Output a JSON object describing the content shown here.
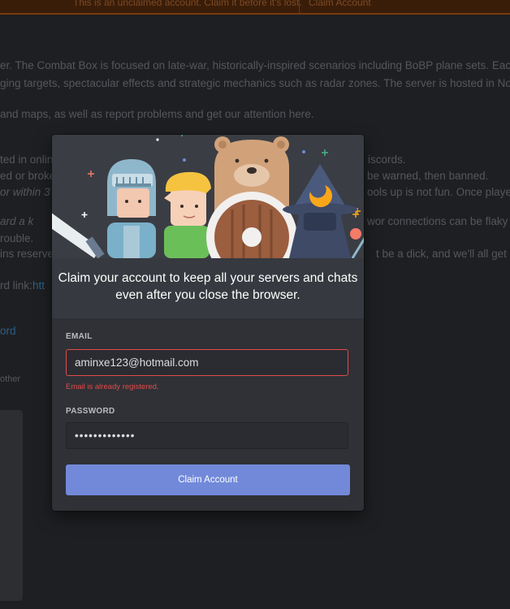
{
  "banner": {
    "message": "This is an unclaimed account. Claim it before it's lost.",
    "button_label": "Claim Account"
  },
  "background": {
    "lines": [
      "er. The Combat Box is focused on late-war, historically-inspired scenarios including BoBP plane sets. Each ma",
      "ging targets, spectacular effects and strategic mechanics such as radar zones. The server is hosted in North A",
      "and maps, as well as report problems and get our attention here.",
      "ted in onlin",
      "iscords.",
      "ed or broke",
      "be warned, then banned.",
      "or within 3",
      "ools up is not fun. Once players",
      "ard a k",
      "wor connections can be flaky a",
      "rouble.",
      "ins reserve",
      "t be a dick, and we'll all get a",
      "rd link: ",
      "htt",
      "ord",
      "other"
    ]
  },
  "modal": {
    "headline_line1": "Claim your account to keep all your servers and chats",
    "headline_line2": "even after you close the browser.",
    "email": {
      "label": "EMAIL",
      "value": "aminxe123@hotmail.com",
      "error": "Email is already registered."
    },
    "password": {
      "label": "PASSWORD",
      "value": "•••••••••••••"
    },
    "submit_label": "Claim Account"
  },
  "colors": {
    "accent": "#7289da",
    "error": "#e24a4a",
    "modal_bg": "#36393f",
    "form_bg": "#2f3136",
    "banner_bg": "#3a1d08"
  },
  "icons": [
    "illustration-knight",
    "illustration-elf",
    "illustration-bear-shield",
    "illustration-wizard",
    "illustration-sword",
    "sparkle-icon"
  ]
}
